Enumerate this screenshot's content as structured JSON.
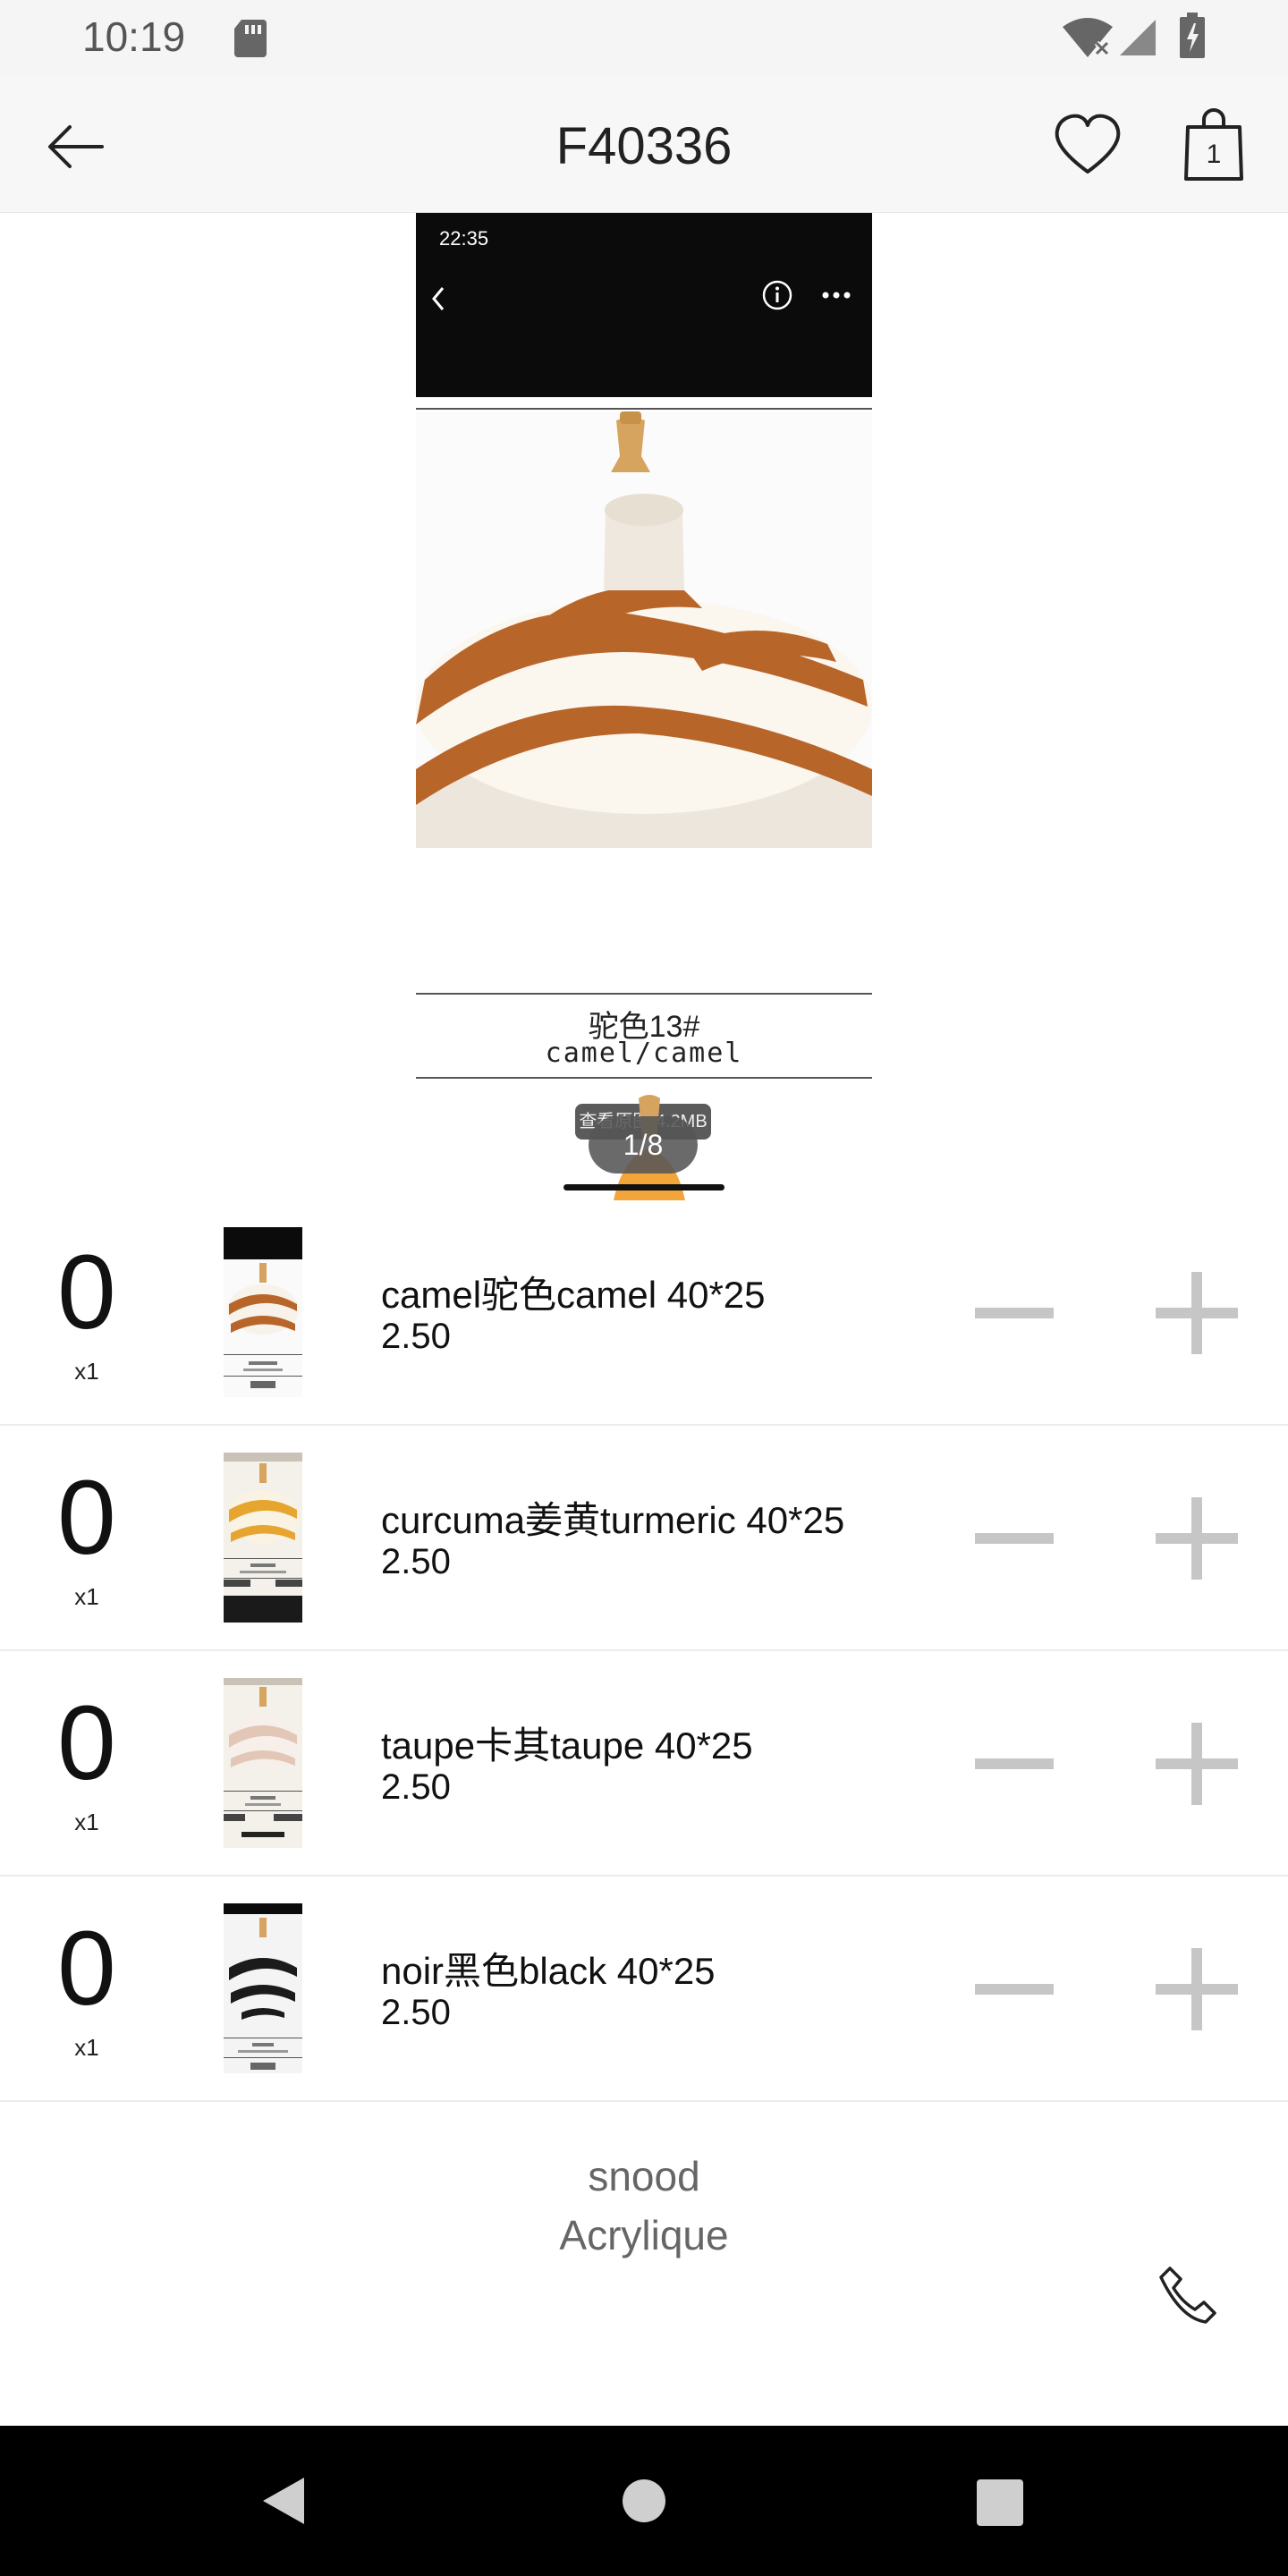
{
  "status_bar": {
    "time": "10:19",
    "icons": [
      "sd-card-icon",
      "wifi-off-icon",
      "signal-icon",
      "battery-charging-icon"
    ]
  },
  "app_bar": {
    "title": "F40336",
    "cart_count": "1",
    "icons": [
      "back-arrow-icon",
      "heart-icon",
      "shopping-bag-icon"
    ]
  },
  "gallery": {
    "embedded_time": "22:35",
    "caption_cn": "驼色13#",
    "caption_en": "camel/camel",
    "view_original_label": "查看原图 4.2MB",
    "pager": "1/8"
  },
  "variants": [
    {
      "qty": "0",
      "multiplier": "x1",
      "name": "camel驼色camel 40*25",
      "price": "2.50",
      "colors": {
        "stripe": "#b8652a",
        "base": "#f7f2ea"
      }
    },
    {
      "qty": "0",
      "multiplier": "x1",
      "name": "curcuma姜黄turmeric 40*25",
      "price": "2.50",
      "colors": {
        "stripe": "#e5a52e",
        "base": "#faf3e4"
      }
    },
    {
      "qty": "0",
      "multiplier": "x1",
      "name": "taupe卡其taupe 40*25",
      "price": "2.50",
      "colors": {
        "stripe": "#e2c7b6",
        "base": "#f7efe9"
      }
    },
    {
      "qty": "0",
      "multiplier": "x1",
      "name": "noir黑色black 40*25",
      "price": "2.50",
      "colors": {
        "stripe": "#1b1b1b",
        "base": "#f4f4f4"
      }
    }
  ],
  "description": {
    "line1": "snood",
    "line2": "Acrylique"
  },
  "colors": {
    "stepper_grey": "#c6c6c6",
    "status_bar_bg": "#f5f5f5",
    "nav_bar_bg": "#000000"
  }
}
